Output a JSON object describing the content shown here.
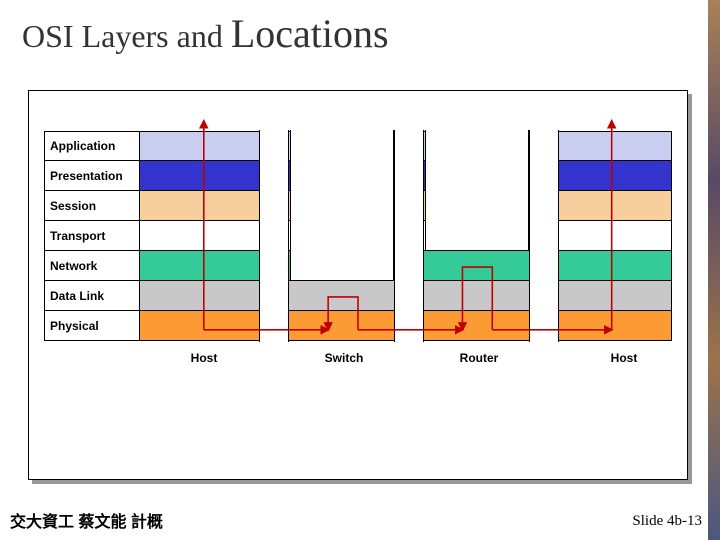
{
  "title": {
    "prefix": "OSI Layers and ",
    "emphasis": "Locations"
  },
  "layers": [
    {
      "label": "Application",
      "color": "c-app"
    },
    {
      "label": "Presentation",
      "color": "c-pres"
    },
    {
      "label": "Session",
      "color": "c-sess"
    },
    {
      "label": "Transport",
      "color": "c-tran"
    },
    {
      "label": "Network",
      "color": "c-net"
    },
    {
      "label": "Data Link",
      "color": "c-data"
    },
    {
      "label": "Physical",
      "color": "c-phys"
    }
  ],
  "devices": [
    {
      "name": "Host",
      "top_layer": "Application"
    },
    {
      "name": "Switch",
      "top_layer": "Data Link"
    },
    {
      "name": "Router",
      "top_layer": "Network"
    },
    {
      "name": "Host",
      "top_layer": "Application"
    }
  ],
  "footer": {
    "left": "交大資工 蔡文能 計概",
    "right": "Slide 4b-13"
  },
  "chart_data": {
    "type": "table",
    "description": "OSI seven-layer model showing which layers each network device implements",
    "rows": [
      "Application",
      "Presentation",
      "Session",
      "Transport",
      "Network",
      "Data Link",
      "Physical"
    ],
    "columns": [
      "Host",
      "Switch",
      "Router",
      "Host"
    ],
    "cells": [
      [
        1,
        0,
        0,
        1
      ],
      [
        1,
        0,
        0,
        1
      ],
      [
        1,
        0,
        0,
        1
      ],
      [
        1,
        0,
        0,
        1
      ],
      [
        1,
        0,
        1,
        1
      ],
      [
        1,
        1,
        1,
        1
      ],
      [
        1,
        1,
        1,
        1
      ]
    ],
    "arrows": [
      {
        "from": "Host-left Application",
        "to": "Host-left Physical"
      },
      {
        "from": "Host-left Physical",
        "to": "Switch Physical"
      },
      {
        "from": "Switch Physical",
        "to": "Switch Data Link",
        "and_back": true
      },
      {
        "from": "Switch Physical",
        "to": "Router Physical"
      },
      {
        "from": "Router Physical",
        "to": "Router Network",
        "and_back": true
      },
      {
        "from": "Router Physical",
        "to": "Host-right Physical"
      },
      {
        "from": "Host-right Physical",
        "to": "Host-right Application"
      }
    ]
  }
}
